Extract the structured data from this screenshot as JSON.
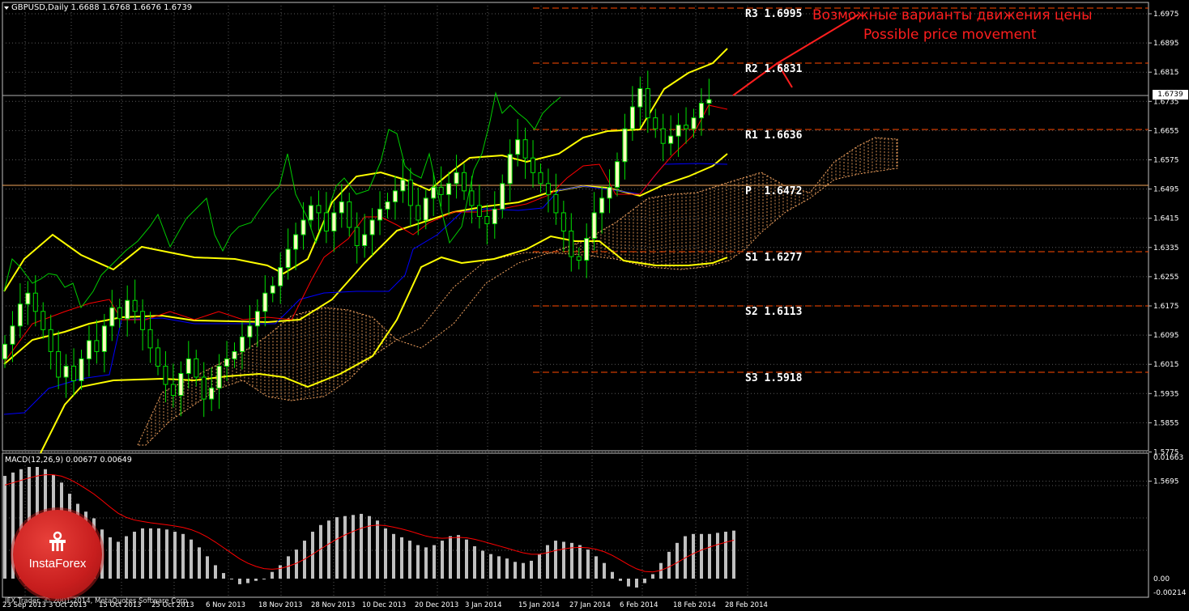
{
  "window": {
    "symbol_title": "GBPUSD,Daily  1.6688 1.6768 1.6676 1.6739",
    "current_price": "1.6739"
  },
  "macd_panel": {
    "title": "MACD(12,26,9) 0.00677 0.00649",
    "scale_top": "0.01663",
    "scale_zero": "0.00",
    "scale_bottom": "-0.00214"
  },
  "price_axis": [
    "1.6975",
    "1.6895",
    "1.6815",
    "1.6735",
    "1.6655",
    "1.6575",
    "1.6495",
    "1.6415",
    "1.6335",
    "1.6255",
    "1.6175",
    "1.6095",
    "1.6015",
    "1.5935",
    "1.5855",
    "1.5775",
    "1.5695"
  ],
  "date_axis": [
    "23 Sep 2013",
    "3 Oct 2013",
    "15 Oct 2013",
    "25 Oct 2013",
    "6 Nov 2013",
    "18 Nov 2013",
    "28 Nov 2013",
    "10 Dec 2013",
    "20 Dec 2013",
    "3 Jan 2014",
    "15 Jan 2014",
    "27 Jan 2014",
    "6 Feb 2014",
    "18 Feb 2014",
    "28 Feb 2014"
  ],
  "pivots": [
    {
      "label": "R3 1.6995"
    },
    {
      "label": "R2 1.6831"
    },
    {
      "label": "R1 1.6636"
    },
    {
      "label": "P  1.6472"
    },
    {
      "label": "S1 1.6277"
    },
    {
      "label": "S2 1.6113"
    },
    {
      "label": "S3 1.5918"
    }
  ],
  "annotation": {
    "line1": "Возможные варианты движения цены",
    "line2": "Possible price movement"
  },
  "copyright": "IFX Trader, © 2001-2014, MetaQuotes Software Corp.",
  "logo": {
    "text": "InstaForex",
    "icon": "instaforex-logo-icon"
  },
  "colors": {
    "background": "#000000",
    "grid": "#5a5a5a",
    "bull_candle": "#fffcc0",
    "bear_candle": "#000000",
    "candle_line": "#00e000",
    "bollinger": "#ffff00",
    "tenkan": "#ff0000",
    "kijun": "#0000ff",
    "chikou": "#00cc00",
    "cloud": "#f4a460",
    "pivot_lines": "#ff4a00",
    "macd_hist": "#c0c0c0",
    "macd_signal": "#ff0000",
    "annotation": "#ff1e1e"
  }
}
